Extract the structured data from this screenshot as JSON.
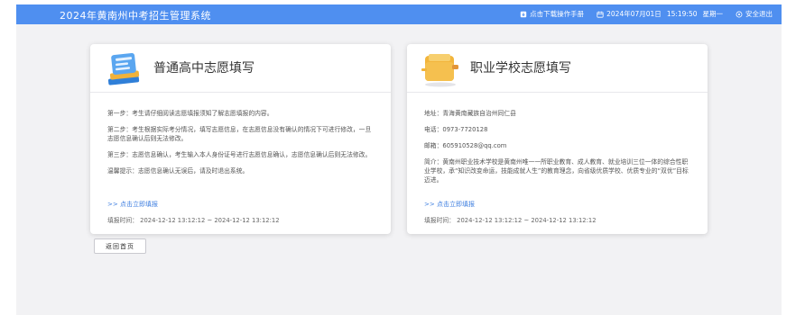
{
  "header": {
    "title": "2024年黄南州中考招生管理系统",
    "download_label": "点击下载操作手册",
    "date": "2024年07月01日",
    "time": "15:19:50",
    "weekday": "星期一",
    "logout_label": "安全退出"
  },
  "cards": [
    {
      "title": "普通高中志愿填写",
      "icon": "book-stack-icon",
      "lines": [
        "第一步：考生请仔细阅读志愿填报须知了解志愿填报的内容。",
        "第二步：考生根据实际考分情况，填写志愿信息，在志愿信息没有确认的情况下可进行修改，一旦志愿信息确认后则无法修改。",
        "第三步：志愿信息确认，考生输入本人身份证号进行志愿信息确认，志愿信息确认后则无法修改。",
        "温馨提示：志愿信息确认无误后，请及时退出系统。"
      ],
      "link": ">> 点击立即填报",
      "time": "填报时间：  2024-12-12 13:12:12 ~ 2024-12-12 13:12:12"
    },
    {
      "title": "职业学校志愿填写",
      "icon": "folder-icon",
      "lines": [
        "地址：青海黄南藏族自治州同仁县",
        "电话：0973-7720128",
        "邮箱：605910528@qq.com",
        "简介：黄南州职业技术学校是黄南州唯一一所职业教育、成人教育、就业培训三位一体的综合性职业学校，承“知识改变命运，技能成就人生”的教育理念，向省级优质学校、优质专业的“双优”目标迈进。"
      ],
      "link": ">> 点击立即填报",
      "time": "填报时间：  2024-12-12 13:12:12 ~ 2024-12-12 13:12:12"
    }
  ],
  "back_button": "返回首页",
  "colors": {
    "topbar": "#4f8ff0",
    "link": "#3f7fe0",
    "background": "#f2f2f4"
  }
}
